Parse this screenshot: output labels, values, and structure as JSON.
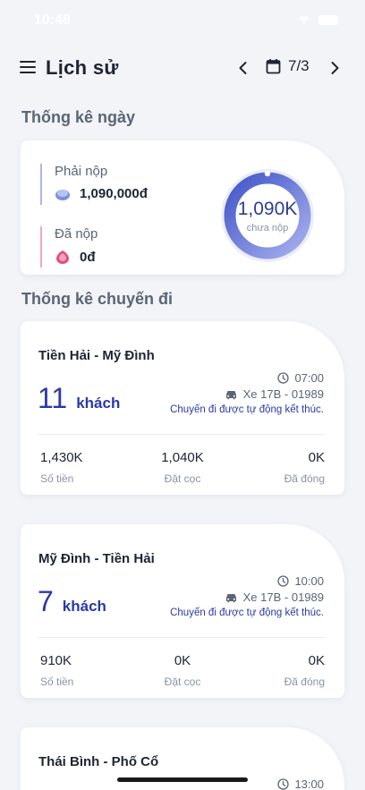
{
  "status_bar": {
    "time": "10:48"
  },
  "header": {
    "title": "Lịch sử",
    "date": "7/3"
  },
  "daily": {
    "section_title": "Thống kê ngày",
    "must_pay_label": "Phải nộp",
    "must_pay_value": "1,090,000đ",
    "paid_label": "Đã nộp",
    "paid_value": "0đ",
    "donut_value": "1,090K",
    "donut_label": "chưa nộp",
    "donut_unpaid_fraction": 1.0
  },
  "trips_section_title": "Thống kê chuyến đi",
  "trips": [
    {
      "route": "Tiền Hải - Mỹ Đình",
      "passengers": "11",
      "passenger_unit": "khách",
      "time": "07:00",
      "vehicle": "Xe 17B - 01989",
      "status": "Chuyến đi được tự động kết thúc.",
      "amount": "1,430K",
      "amount_label": "Số tiền",
      "deposit": "1,040K",
      "deposit_label": "Đặt cọc",
      "closed": "0K",
      "closed_label": "Đã đóng"
    },
    {
      "route": "Mỹ Đình - Tiền Hải",
      "passengers": "7",
      "passenger_unit": "khách",
      "time": "10:00",
      "vehicle": "Xe 17B - 01989",
      "status": "Chuyến đi được tự động kết thúc.",
      "amount": "910K",
      "amount_label": "Số tiền",
      "deposit": "0K",
      "deposit_label": "Đặt cọc",
      "closed": "0K",
      "closed_label": "Đã đóng"
    },
    {
      "route": "Thái Bình - Phố Cổ",
      "time": "13:00"
    }
  ],
  "colors": {
    "accent": "#2a39a8",
    "donut_start": "#4256c8",
    "donut_end": "#9ca6ea",
    "background": "#f3f4f8"
  }
}
